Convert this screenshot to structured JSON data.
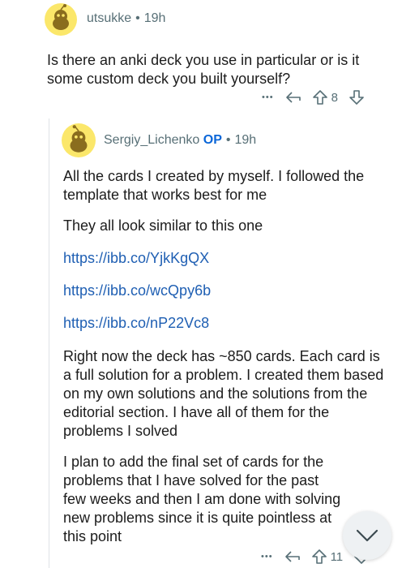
{
  "comment1": {
    "username": "utsukke",
    "time": "19h",
    "body": "Is there an anki deck you use in particular or is it some custom deck you built yourself?",
    "actions": {
      "more": "•••",
      "score": "8"
    }
  },
  "comment2": {
    "username": "Sergiy_Lichenko",
    "op_badge": "OP",
    "time": "19h",
    "p1": "All the cards I created by myself. I followed the template that works best for me",
    "p2": "They all look similar to this one",
    "links": [
      "https://ibb.co/YjkKgQX",
      "https://ibb.co/wcQpy6b",
      "https://ibb.co/nP22Vc8"
    ],
    "p3": "Right now the deck has ~850 cards. Each card is a full solution for a problem. I created them based on my own solutions and the solutions from the editorial section. I have all of them for the problems I solved",
    "p4": "I plan to add the final set of cards for the problems that I have solved for the past few weeks and then I am done with solving new problems since it is quite pointless at this point",
    "actions": {
      "more": "•••",
      "score": "11"
    }
  },
  "colors": {
    "accent": "#0a66d8",
    "link": "#1f5fb3",
    "avatar": "#fbe76a"
  },
  "icons": [
    "snoo-avatar-icon",
    "reply-icon",
    "upvote-icon",
    "downvote-icon",
    "more-icon",
    "chevron-down-icon"
  ]
}
